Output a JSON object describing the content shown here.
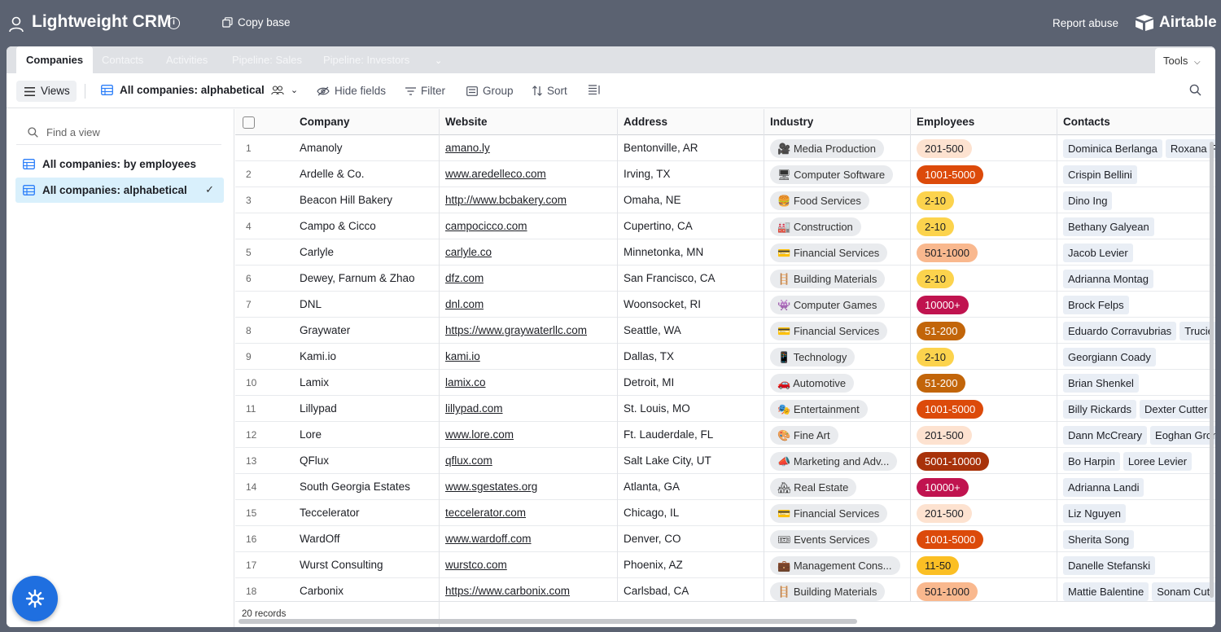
{
  "app": {
    "base_title": "Lightweight CRM",
    "copy_base": "Copy base",
    "report_abuse": "Report abuse",
    "brand": "Airtable"
  },
  "tabs": [
    {
      "label": "Companies",
      "active": true
    },
    {
      "label": "Contacts"
    },
    {
      "label": "Activities"
    },
    {
      "label": "Pipeline: Sales"
    },
    {
      "label": "Pipeline: Investors"
    }
  ],
  "tools_label": "Tools",
  "viewbar": {
    "views_label": "Views",
    "current_view": "All companies: alphabetical",
    "hide_fields": "Hide fields",
    "filter": "Filter",
    "group": "Group",
    "sort": "Sort"
  },
  "sidebar": {
    "find_placeholder": "Find a view",
    "views": [
      {
        "label": "All companies: by employees"
      },
      {
        "label": "All companies: alphabetical",
        "selected": true
      }
    ]
  },
  "grid": {
    "columns": [
      "Company",
      "Website",
      "Address",
      "Industry",
      "Employees",
      "Contacts"
    ],
    "rows": [
      {
        "n": "1",
        "company": "Amanoly",
        "website": "amano.ly",
        "address": "Bentonville, AR",
        "industry": "Media Production",
        "icon": "🎥",
        "employees": "201-500",
        "contacts": [
          "Dominica Berlanga",
          "Roxana F"
        ]
      },
      {
        "n": "2",
        "company": "Ardelle & Co.",
        "website": "www.aredelleco.com",
        "address": "Irving, TX",
        "industry": "Computer Software",
        "icon": "🖥",
        "employees": "1001-5000",
        "contacts": [
          "Crispin Bellini"
        ]
      },
      {
        "n": "3",
        "company": "Beacon Hill Bakery",
        "website": "http://www.bcbakery.com",
        "address": "Omaha, NE",
        "industry": "Food Services",
        "icon": "🍔",
        "employees": "2-10",
        "contacts": [
          "Dino Ing"
        ]
      },
      {
        "n": "4",
        "company": "Campo & Cicco",
        "website": "campocicco.com",
        "address": "Cupertino, CA",
        "industry": "Construction",
        "icon": "🏭",
        "employees": "2-10",
        "contacts": [
          "Bethany Galyean"
        ]
      },
      {
        "n": "5",
        "company": "Carlyle",
        "website": "carlyle.co",
        "address": "Minnetonka, MN",
        "industry": "Financial Services",
        "icon": "💳",
        "employees": "501-1000",
        "contacts": [
          "Jacob Levier"
        ]
      },
      {
        "n": "6",
        "company": "Dewey, Farnum & Zhao",
        "website": "dfz.com",
        "address": "San Francisco, CA",
        "industry": "Building Materials",
        "icon": "🪜",
        "employees": "2-10",
        "contacts": [
          "Adrianna Montag"
        ]
      },
      {
        "n": "7",
        "company": "DNL",
        "website": "dnl.com",
        "address": "Woonsocket, RI",
        "industry": "Computer Games",
        "icon": "👾",
        "employees": "10000+",
        "contacts": [
          "Brock Felps"
        ]
      },
      {
        "n": "8",
        "company": "Graywater",
        "website": "https://www.graywaterllc.com",
        "address": "Seattle, WA",
        "industry": "Financial Services",
        "icon": "💳",
        "employees": "51-200",
        "contacts": [
          "Eduardo Corravubrias",
          "Trucie"
        ]
      },
      {
        "n": "9",
        "company": "Kami.io",
        "website": "kami.io",
        "address": "Dallas, TX",
        "industry": "Technology",
        "icon": "📱",
        "employees": "2-10",
        "contacts": [
          "Georgiann Coady"
        ]
      },
      {
        "n": "10",
        "company": "Lamix",
        "website": "lamix.co",
        "address": "Detroit, MI",
        "industry": "Automotive",
        "icon": "🚗",
        "employees": "51-200",
        "contacts": [
          "Brian Shenkel"
        ]
      },
      {
        "n": "11",
        "company": "Lillypad",
        "website": "lillypad.com",
        "address": "St. Louis, MO",
        "industry": "Entertainment",
        "icon": "🎭",
        "employees": "1001-5000",
        "contacts": [
          "Billy Rickards",
          "Dexter Cutter"
        ]
      },
      {
        "n": "12",
        "company": "Lore",
        "website": "www.lore.com",
        "address": "Ft. Lauderdale, FL",
        "industry": "Fine Art",
        "icon": "🎨",
        "employees": "201-500",
        "contacts": [
          "Dann McCreary",
          "Eoghan Gron"
        ]
      },
      {
        "n": "13",
        "company": "QFlux",
        "website": "qflux.com",
        "address": "Salt Lake City, UT",
        "industry": "Marketing and Adv...",
        "icon": "📣",
        "employees": "5001-10000",
        "contacts": [
          "Bo Harpin",
          "Loree Levier"
        ]
      },
      {
        "n": "14",
        "company": "South Georgia Estates",
        "website": "www.sgestates.org",
        "address": "Atlanta, GA",
        "industry": "Real Estate",
        "icon": "🏘",
        "employees": "10000+",
        "contacts": [
          "Adrianna Landi"
        ]
      },
      {
        "n": "15",
        "company": "Teccelerator",
        "website": "teccelerator.com",
        "address": "Chicago, IL",
        "industry": "Financial Services",
        "icon": "💳",
        "employees": "201-500",
        "contacts": [
          "Liz Nguyen"
        ]
      },
      {
        "n": "16",
        "company": "WardOff",
        "website": "www.wardoff.com",
        "address": "Denver, CO",
        "industry": "Events Services",
        "icon": "🎟",
        "employees": "1001-5000",
        "contacts": [
          "Sherita Song"
        ]
      },
      {
        "n": "17",
        "company": "Wurst Consulting",
        "website": "wurstco.com",
        "address": "Phoenix, AZ",
        "industry": "Management Cons...",
        "icon": "💼",
        "employees": "11-50",
        "contacts": [
          "Danelle Stefanski"
        ]
      },
      {
        "n": "18",
        "company": "Carbonix",
        "website": "https://www.carbonix.com",
        "address": "Carlsbad, CA",
        "industry": "Building Materials",
        "icon": "🪜",
        "employees": "501-1000",
        "contacts": [
          "Mattie Balentine",
          "Sonam Cutt"
        ]
      }
    ],
    "record_count": "20 records"
  },
  "employee_colors": {
    "2-10": {
      "bg": "#fcd34d",
      "fg": "#1d1f25"
    },
    "11-50": {
      "bg": "#fbbf24",
      "fg": "#1d1f25"
    },
    "51-200": {
      "bg": "#c2650a",
      "fg": "#ffffff"
    },
    "201-500": {
      "bg": "#fde2d0",
      "fg": "#1d1f25"
    },
    "501-1000": {
      "bg": "#f9b88e",
      "fg": "#1d1f25"
    },
    "1001-5000": {
      "bg": "#dc4a0a",
      "fg": "#ffffff"
    },
    "5001-10000": {
      "bg": "#a8320a",
      "fg": "#ffffff"
    },
    "10000+": {
      "bg": "#c0134f",
      "fg": "#ffffff"
    }
  }
}
